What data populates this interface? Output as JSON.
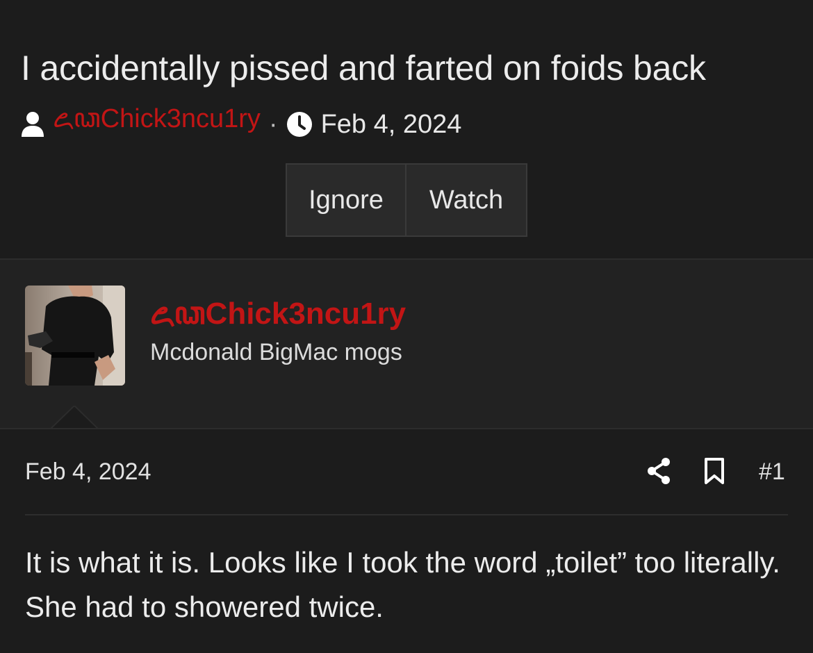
{
  "thread": {
    "title": "I accidentally pissed and farted on foids back",
    "author": "ꦌꦣChick3ncu1ry",
    "separator": "·",
    "date": "Feb 4, 2024",
    "buttons": {
      "ignore": "Ignore",
      "watch": "Watch"
    }
  },
  "post": {
    "username": "ꦌꦣChick3ncu1ry",
    "user_title": "Mcdonald BigMac mogs",
    "date": "Feb 4, 2024",
    "number": "#1",
    "body": "It is what it is. Looks like I took the word „toilet” too literally. She had to showered twice."
  },
  "colors": {
    "accent": "#c21515",
    "background": "#1c1c1c",
    "panel": "#222222"
  },
  "icons": [
    "user-icon",
    "clock-icon",
    "share-icon",
    "bookmark-icon"
  ]
}
